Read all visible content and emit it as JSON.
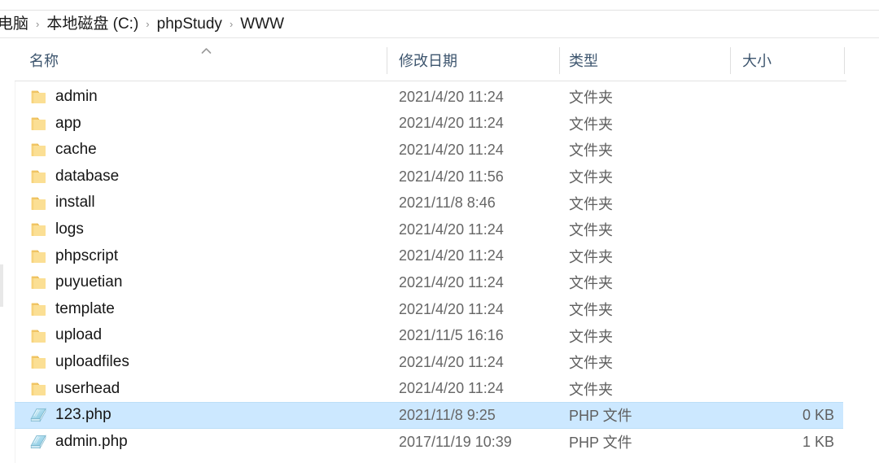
{
  "window": {
    "app": "Windows File Explorer"
  },
  "breadcrumb": {
    "separator": "›",
    "items": [
      {
        "label": "电脑"
      },
      {
        "label": "本地磁盘 (C:)"
      },
      {
        "label": "phpStudy"
      },
      {
        "label": "WWW"
      }
    ]
  },
  "columns": {
    "sort": {
      "column": "name",
      "direction": "ascending",
      "glyph": "⌃"
    },
    "headers": [
      {
        "key": "name",
        "label": "名称"
      },
      {
        "key": "date",
        "label": "修改日期"
      },
      {
        "key": "type",
        "label": "类型"
      },
      {
        "key": "size",
        "label": "大小"
      }
    ]
  },
  "colors": {
    "selection": "#cce8ff",
    "selection_border": "#bcdff7",
    "folder_icon": "#f5cc6b",
    "php_icon": "#9fd4e8",
    "header_text": "#3d556e",
    "name_text": "#161616",
    "meta_text": "#666666"
  },
  "files": [
    {
      "name": "admin",
      "icon": "folder-icon",
      "date": "2021/4/20 11:24",
      "type": "文件夹",
      "size": "",
      "selected": false
    },
    {
      "name": "app",
      "icon": "folder-icon",
      "date": "2021/4/20 11:24",
      "type": "文件夹",
      "size": "",
      "selected": false
    },
    {
      "name": "cache",
      "icon": "folder-icon",
      "date": "2021/4/20 11:24",
      "type": "文件夹",
      "size": "",
      "selected": false
    },
    {
      "name": "database",
      "icon": "folder-icon",
      "date": "2021/4/20 11:56",
      "type": "文件夹",
      "size": "",
      "selected": false
    },
    {
      "name": "install",
      "icon": "folder-icon",
      "date": "2021/11/8 8:46",
      "type": "文件夹",
      "size": "",
      "selected": false
    },
    {
      "name": "logs",
      "icon": "folder-icon",
      "date": "2021/4/20 11:24",
      "type": "文件夹",
      "size": "",
      "selected": false
    },
    {
      "name": "phpscript",
      "icon": "folder-icon",
      "date": "2021/4/20 11:24",
      "type": "文件夹",
      "size": "",
      "selected": false
    },
    {
      "name": "puyuetian",
      "icon": "folder-icon",
      "date": "2021/4/20 11:24",
      "type": "文件夹",
      "size": "",
      "selected": false
    },
    {
      "name": "template",
      "icon": "folder-icon",
      "date": "2021/4/20 11:24",
      "type": "文件夹",
      "size": "",
      "selected": false
    },
    {
      "name": "upload",
      "icon": "folder-icon",
      "date": "2021/11/5 16:16",
      "type": "文件夹",
      "size": "",
      "selected": false
    },
    {
      "name": "uploadfiles",
      "icon": "folder-icon",
      "date": "2021/4/20 11:24",
      "type": "文件夹",
      "size": "",
      "selected": false
    },
    {
      "name": "userhead",
      "icon": "folder-icon",
      "date": "2021/4/20 11:24",
      "type": "文件夹",
      "size": "",
      "selected": false
    },
    {
      "name": "123.php",
      "icon": "php-file-icon",
      "date": "2021/11/8 9:25",
      "type": "PHP 文件",
      "size": "0 KB",
      "selected": true
    },
    {
      "name": "admin.php",
      "icon": "php-file-icon",
      "date": "2017/11/19 10:39",
      "type": "PHP 文件",
      "size": "1 KB",
      "selected": false
    }
  ]
}
